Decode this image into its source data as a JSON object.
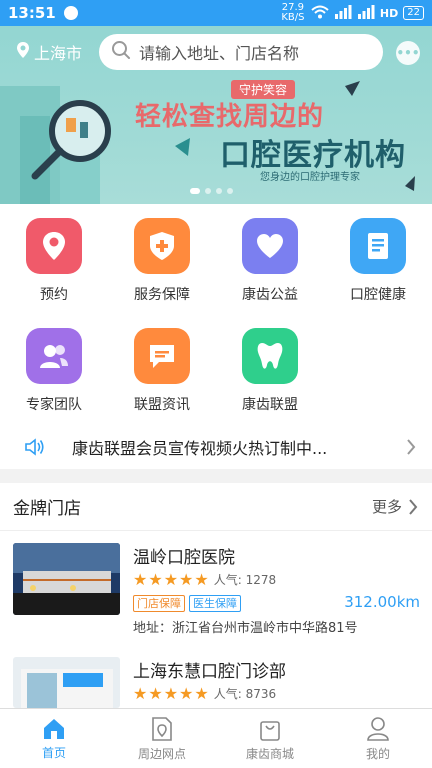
{
  "status": {
    "time": "13:51",
    "net_speed": "27.9 KB/S",
    "battery": "22"
  },
  "header": {
    "city": "上海市",
    "search_placeholder": "请输入地址、门店名称"
  },
  "banner": {
    "tag": "守护笑容",
    "line1": "轻松查找周边的",
    "line2": "口腔医疗机构",
    "line3": "您身边的口腔护理专家"
  },
  "grid": [
    {
      "label": "预约",
      "icon": "location-pin-icon",
      "color": "#f05a6a"
    },
    {
      "label": "服务保障",
      "icon": "shield-plus-icon",
      "color": "#ff8a3d"
    },
    {
      "label": "康齿公益",
      "icon": "heart-icon",
      "color": "#7b7ff0"
    },
    {
      "label": "口腔健康",
      "icon": "book-icon",
      "color": "#3fa7f5"
    },
    {
      "label": "专家团队",
      "icon": "people-icon",
      "color": "#a070e8"
    },
    {
      "label": "联盟资讯",
      "icon": "message-icon",
      "color": "#ff8a3d"
    },
    {
      "label": "康齿联盟",
      "icon": "tooth-icon",
      "color": "#2fcf8c"
    }
  ],
  "notice": {
    "text": "康齿联盟会员宣传视频火热订制中..."
  },
  "section": {
    "title": "金牌门店",
    "more": "更多"
  },
  "stores": [
    {
      "name": "温岭口腔医院",
      "stars": 5,
      "popularity_label": "人气:",
      "popularity": "1278",
      "tags": [
        "门店保障",
        "医生保障"
      ],
      "distance": "312.00km",
      "address": "地址：浙江省台州市温岭市中华路81号"
    },
    {
      "name": "上海东慧口腔门诊部",
      "stars": 5,
      "popularity_label": "人气:",
      "popularity": "8736",
      "tags": [],
      "distance": "",
      "address": ""
    }
  ],
  "tabbar": [
    {
      "label": "首页",
      "icon": "home-icon",
      "active": true
    },
    {
      "label": "周边网点",
      "icon": "nearby-icon",
      "active": false
    },
    {
      "label": "康齿商城",
      "icon": "shopping-bag-icon",
      "active": false
    },
    {
      "label": "我的",
      "icon": "user-icon",
      "active": false
    }
  ],
  "colors": {
    "primary": "#2f9ff4",
    "star": "#f59a23",
    "tag_orange": "#f08a2c",
    "tag_blue": "#2f9ff4"
  }
}
